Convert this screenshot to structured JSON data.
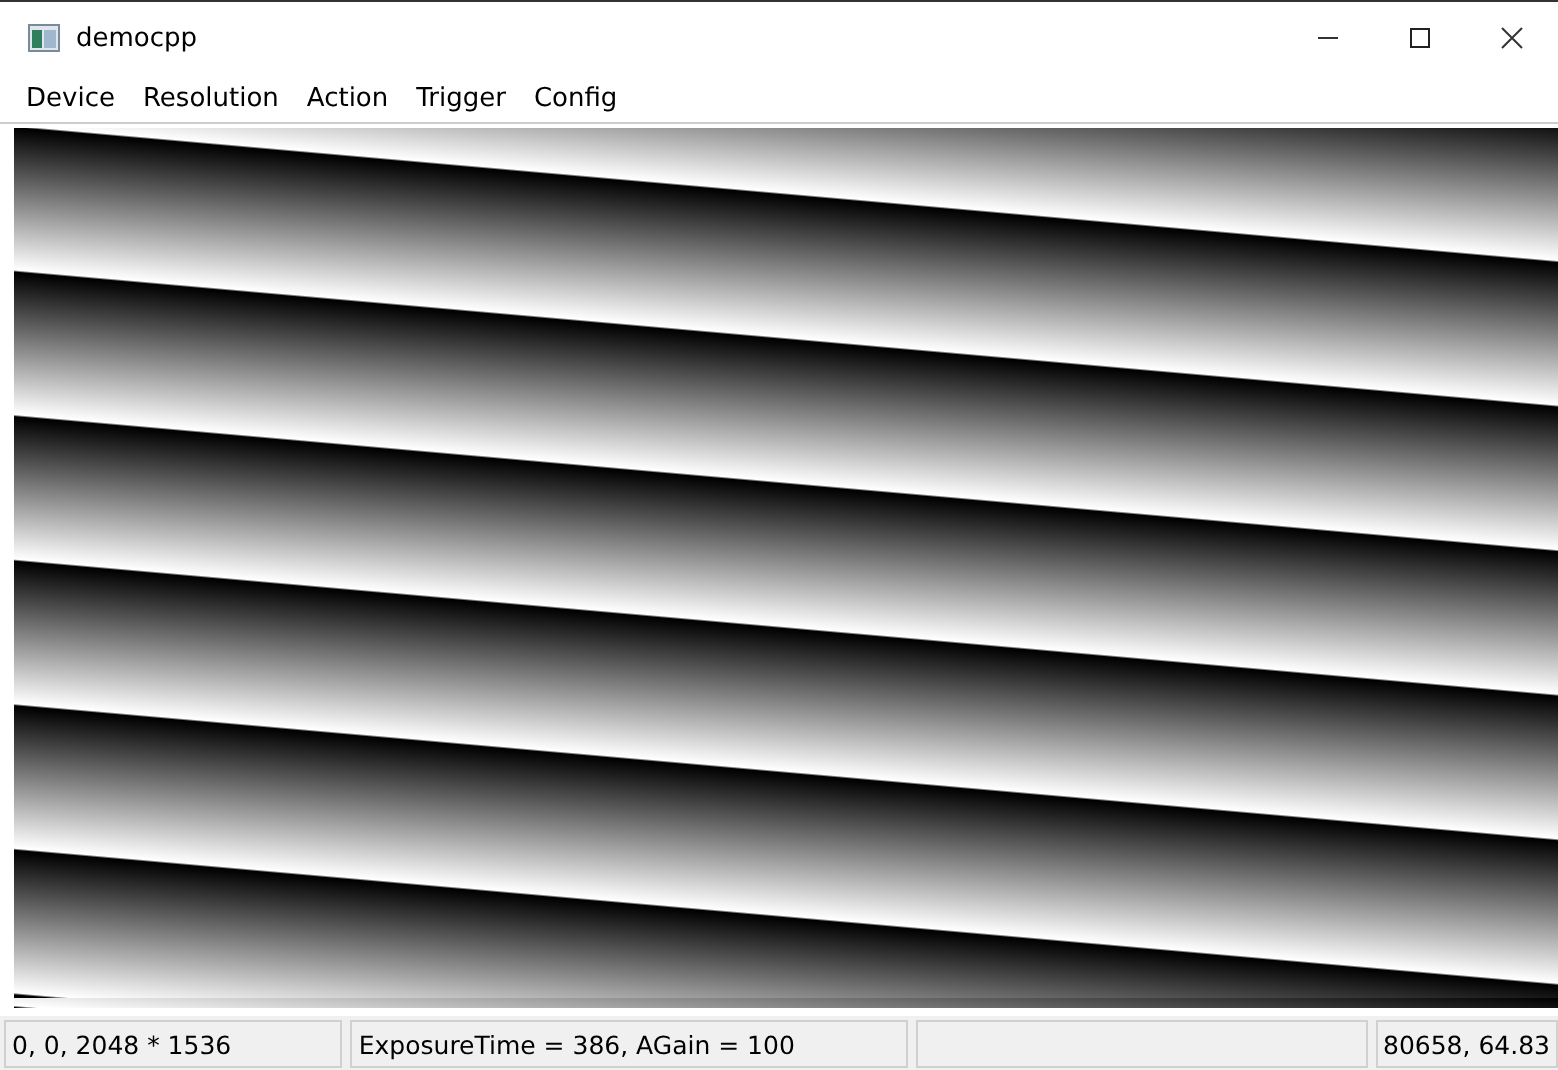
{
  "window": {
    "title": "democpp"
  },
  "menu": [
    "Device",
    "Resolution",
    "Action",
    "Trigger",
    "Config"
  ],
  "status_bar": [
    {
      "kind": "text",
      "text": "0, 0, 2048 * 1536"
    },
    {
      "kind": "text",
      "text": "ExposureTime = 386, AGain = 100"
    },
    {
      "kind": "blank"
    },
    {
      "kind": "text",
      "text": "80658, 64.83"
    }
  ]
}
